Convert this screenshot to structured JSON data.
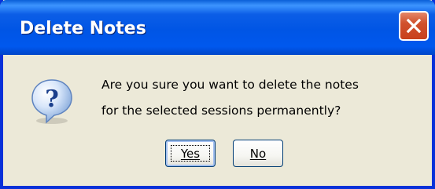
{
  "dialog": {
    "title": "Delete Notes",
    "message_line1": "Are you sure you want to delete the notes",
    "message_line2": "for the selected sessions permanently?",
    "icon": "question-icon",
    "buttons": {
      "yes_label": "Yes",
      "no_label": "No"
    },
    "colors": {
      "titlebar": "#0055e5",
      "background": "#ece9d8",
      "close_button": "#c8401d"
    }
  }
}
